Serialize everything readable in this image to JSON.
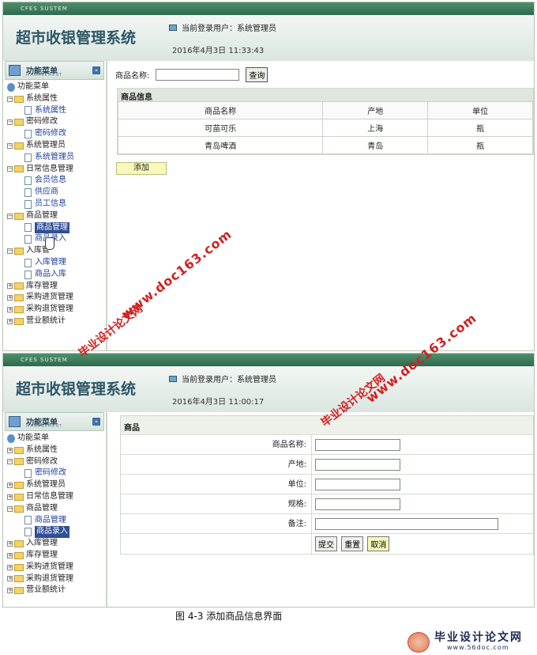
{
  "s1": {
    "topbar": "CFES SUSTEM",
    "title": "超市收银管理系统",
    "user": "当前登录用户：系统管理员",
    "date": "2016年4月3日   11:33:43",
    "menu": {
      "title": "功能菜单",
      "sub": "MANAGEMENT",
      "toggle": "»"
    },
    "tree": [
      {
        "t": "root",
        "label": "功能菜单"
      },
      {
        "t": "folder",
        "pm": "−",
        "label": "系统属性"
      },
      {
        "t": "leaf",
        "label": "系统属性"
      },
      {
        "t": "folder",
        "pm": "−",
        "label": "密码修改"
      },
      {
        "t": "leaf",
        "label": "密码修改"
      },
      {
        "t": "folder",
        "pm": "−",
        "label": "系统管理员"
      },
      {
        "t": "leaf",
        "label": "系统管理员"
      },
      {
        "t": "folder",
        "pm": "−",
        "label": "日常信息管理"
      },
      {
        "t": "leaf",
        "label": "会员信息"
      },
      {
        "t": "leaf",
        "label": "供应商"
      },
      {
        "t": "leaf",
        "label": "员工信息"
      },
      {
        "t": "folder",
        "pm": "−",
        "label": "商品管理"
      },
      {
        "t": "leaf",
        "label": "商品管理",
        "sel": true
      },
      {
        "t": "leaf",
        "label": "商品录入"
      },
      {
        "t": "folder",
        "pm": "−",
        "label": "入库管"
      },
      {
        "t": "leaf",
        "label": "入库管理"
      },
      {
        "t": "leaf",
        "label": "商品入库"
      },
      {
        "t": "folder",
        "pm": "+",
        "label": "库存管理"
      },
      {
        "t": "folder",
        "pm": "+",
        "label": "采购进货管理"
      },
      {
        "t": "folder",
        "pm": "+",
        "label": "采购退货管理"
      },
      {
        "t": "folder",
        "pm": "+",
        "label": "营业额统计"
      }
    ],
    "search_label": "商品名称:",
    "search_button": "查询",
    "panel_title": "商品信息",
    "columns": [
      "商品名称",
      "产地",
      "单位"
    ],
    "rows": [
      [
        "可苗可乐",
        "上海",
        "瓶"
      ],
      [
        "青岛啤酒",
        "青岛",
        "瓶"
      ]
    ],
    "add_button": "添加"
  },
  "s2": {
    "topbar": "CFES SUSTEM",
    "title": "超市收银管理系统",
    "user": "当前登录用户：系统管理员",
    "date": "2016年4月3日   11:00:17",
    "menu": {
      "title": "功能菜单",
      "sub": "MANAGEMENT",
      "toggle": "»"
    },
    "tree": [
      {
        "t": "root",
        "label": "功能菜单"
      },
      {
        "t": "folder",
        "pm": "+",
        "label": "系统属性"
      },
      {
        "t": "folder",
        "pm": "−",
        "label": "密码修改"
      },
      {
        "t": "leaf",
        "label": "密码修改"
      },
      {
        "t": "folder",
        "pm": "+",
        "label": "系统管理员"
      },
      {
        "t": "folder",
        "pm": "+",
        "label": "日常信息管理"
      },
      {
        "t": "folder",
        "pm": "−",
        "label": "商品管理"
      },
      {
        "t": "leaf",
        "label": "商品管理"
      },
      {
        "t": "leaf",
        "label": "商品录入",
        "sel": true
      },
      {
        "t": "folder",
        "pm": "+",
        "label": "入库管理"
      },
      {
        "t": "folder",
        "pm": "+",
        "label": "库存管理"
      },
      {
        "t": "folder",
        "pm": "+",
        "label": "采购进货管理"
      },
      {
        "t": "folder",
        "pm": "+",
        "label": "采购退货管理"
      },
      {
        "t": "folder",
        "pm": "+",
        "label": "营业额统计"
      }
    ],
    "form_title": "商品",
    "fields": [
      "商品名称:",
      "产地:",
      "单位:",
      "规格:",
      "备注:"
    ],
    "buttons": {
      "submit": "提交",
      "reset": "重置",
      "cancel": "取消"
    }
  },
  "caption": "图 4-3   添加商品信息界面",
  "watermark": {
    "url": "www.doc163.com",
    "cn": "毕业设计论文网"
  },
  "footer": {
    "logo": "毕业设计论文网",
    "url": "www.56doc.com"
  }
}
